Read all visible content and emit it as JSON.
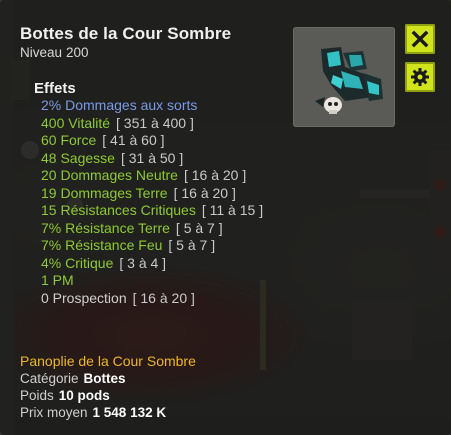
{
  "item": {
    "name": "Bottes de la Cour Sombre",
    "level_label": "Niveau",
    "level": "200"
  },
  "icons": {
    "close": "close-icon",
    "settings": "gear-icon",
    "item": "boots-icon"
  },
  "colors": {
    "accent_button": "#cfe41a",
    "effect_blue": "#7a9ae6",
    "effect_green": "#8ecb2e",
    "set_gold": "#f0b722"
  },
  "effects_title": "Effets",
  "effects": [
    {
      "text": "2% Dommages aux sorts",
      "range": "",
      "color": "blue"
    },
    {
      "text": "400 Vitalité",
      "range": "[ 351 à 400 ]",
      "color": "green"
    },
    {
      "text": "60 Force",
      "range": "[ 41 à 60 ]",
      "color": "green"
    },
    {
      "text": "48 Sagesse",
      "range": "[ 31 à 50 ]",
      "color": "green"
    },
    {
      "text": "20 Dommages Neutre",
      "range": "[ 16 à 20 ]",
      "color": "green"
    },
    {
      "text": "19 Dommages Terre",
      "range": "[ 16 à 20 ]",
      "color": "green"
    },
    {
      "text": "15 Résistances Critiques",
      "range": "[ 11 à 15 ]",
      "color": "green"
    },
    {
      "text": "7% Résistance Terre",
      "range": "[ 5 à 7 ]",
      "color": "green"
    },
    {
      "text": "7% Résistance Feu",
      "range": "[ 5 à 7 ]",
      "color": "green"
    },
    {
      "text": "4% Critique",
      "range": "[ 3 à 4 ]",
      "color": "green"
    },
    {
      "text": "1 PM",
      "range": "",
      "color": "green"
    },
    {
      "text": "0 Prospection",
      "range": "[ 16 à 20 ]",
      "color": "grey"
    }
  ],
  "set_name": "Panoplie de la Cour Sombre",
  "info": {
    "category_label": "Catégorie",
    "category_value": "Bottes",
    "weight_label": "Poids",
    "weight_value": "10 pods",
    "price_label": "Prix moyen",
    "price_value": "1 548 132 K"
  }
}
